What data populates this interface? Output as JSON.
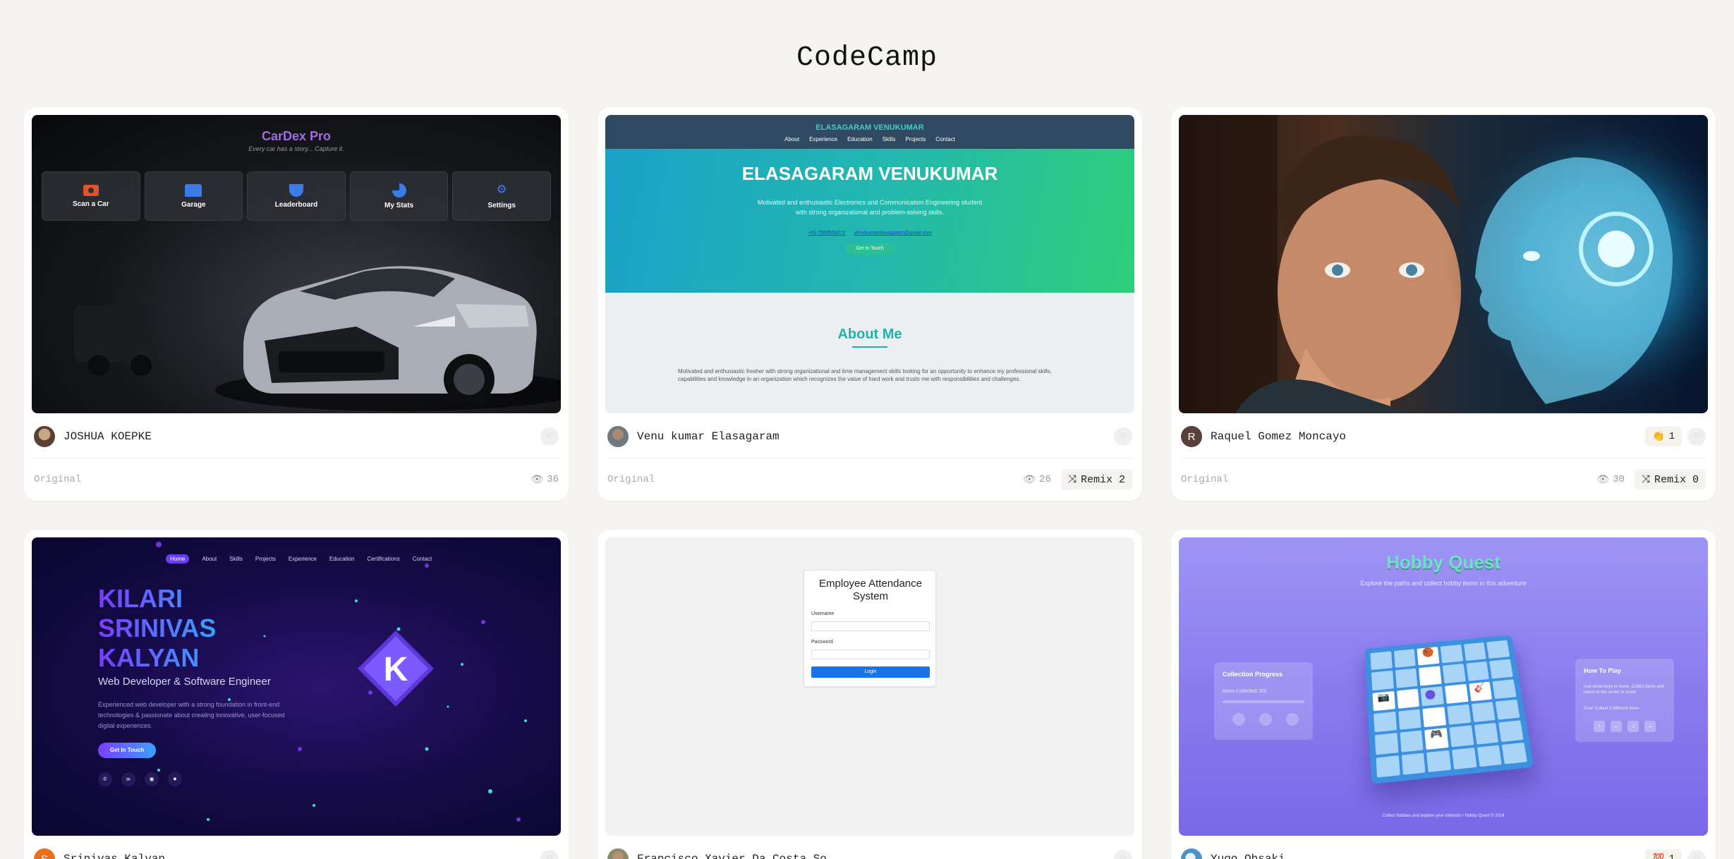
{
  "site": {
    "title": "CodeCamp"
  },
  "cards": [
    {
      "author": "JOSHUA KOEPKE",
      "label": "Original",
      "views": "36",
      "preview": {
        "title": "CarDex Pro",
        "tagline": "Every car has a story... Capture it.",
        "menu": [
          "Scan a Car",
          "Garage",
          "Leaderboard",
          "My Stats",
          "Settings"
        ]
      }
    },
    {
      "author": "Venu kumar Elasagaram",
      "label": "Original",
      "views": "26",
      "remix": "Remix 2",
      "preview": {
        "brand": "ELASAGARAM VENUKUMAR",
        "nav": [
          "About",
          "Experience",
          "Education",
          "Skills",
          "Projects",
          "Contact"
        ],
        "hero_name": "ELASAGARAM VENUKUMAR",
        "hero_text": "Motivated and enthusiastic Electronics and Communication Engineering student with strong organizational and problem-solving skills.",
        "phone": "+91-7569569272",
        "email": "venukumarelasagaram@gmail.com",
        "cta": "Get In Touch",
        "section_title": "About Me",
        "section_text": "Motivated and enthusiastic fresher with strong organizational and time management skills looking for an opportunity to enhance my professional skills, capabilities and knowledge in an organization which recognizes the value of hard work and trusts me with responsibilities and challenges."
      }
    },
    {
      "author": "Raquel Gomez Moncayo",
      "avatar_letter": "R",
      "label": "Original",
      "views": "30",
      "remix": "Remix 0",
      "reaction": {
        "emoji": "👏",
        "count": "1"
      }
    },
    {
      "author": "Srinivas Kalyan",
      "avatar_letter": "S",
      "preview": {
        "nav": [
          "Home",
          "About",
          "Skills",
          "Projects",
          "Experience",
          "Education",
          "Certifications",
          "Contact"
        ],
        "name_lines": [
          "KILARI",
          "SRINIVAS",
          "KALYAN"
        ],
        "role": "Web Developer & Software Engineer",
        "bio": "Experienced web developer with a strong foundation in front-end technologies & passionate about creating innovative, user-focused digital experiences.",
        "cta": "Get In Touch",
        "logo_letter": "K"
      }
    },
    {
      "author": "Francisco Xavier Da Costa So...",
      "preview": {
        "title": "Employee Attendance System",
        "username_label": "Username",
        "password_label": "Password",
        "button": "Login"
      }
    },
    {
      "author": "Yugo Ohsaki",
      "reaction": {
        "emoji": "💯",
        "count": "1"
      },
      "preview": {
        "title": "Hobby Quest",
        "subtitle": "Explore the paths and collect hobby items in this adventure",
        "progress_title": "Collection Progress",
        "progress_text": "Items Collected: 0/3",
        "howto_title": "How To Play",
        "howto_text": "Use arrow keys to move. Collect items and return to the center to reset!",
        "howto_goal": "Goal: Collect 3 different items",
        "arrows": [
          "↑",
          "←",
          "↓",
          "→"
        ],
        "footer": "Collect hobbies and explore your interests • Hobby Quest © 2024"
      }
    }
  ]
}
